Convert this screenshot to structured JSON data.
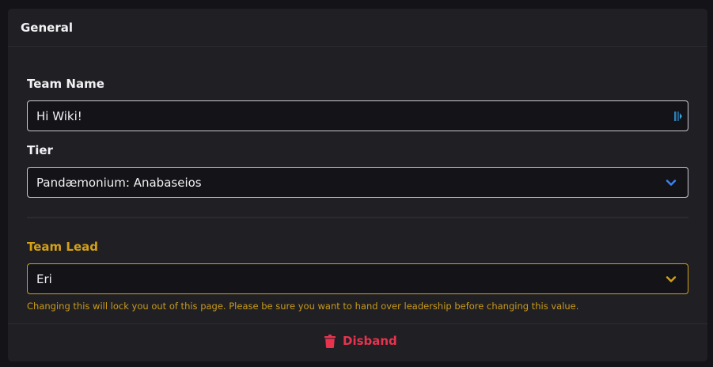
{
  "header": {
    "title": "General"
  },
  "team_name": {
    "label": "Team Name",
    "value": "Hi Wiki!"
  },
  "tier": {
    "label": "Tier",
    "selected": "Pandæmonium: Anabaseios"
  },
  "team_lead": {
    "label": "Team Lead",
    "selected": "Eri",
    "help": "Changing this will lock you out of this page. Please be sure you want to hand over leadership before changing this value."
  },
  "footer": {
    "disband_label": "Disband"
  },
  "colors": {
    "accent_blue": "#3b82f6",
    "warning": "#d4a116",
    "danger": "#e8334e"
  },
  "icons": [
    "password-manager-icon",
    "chevron-down-icon",
    "trash-icon"
  ]
}
